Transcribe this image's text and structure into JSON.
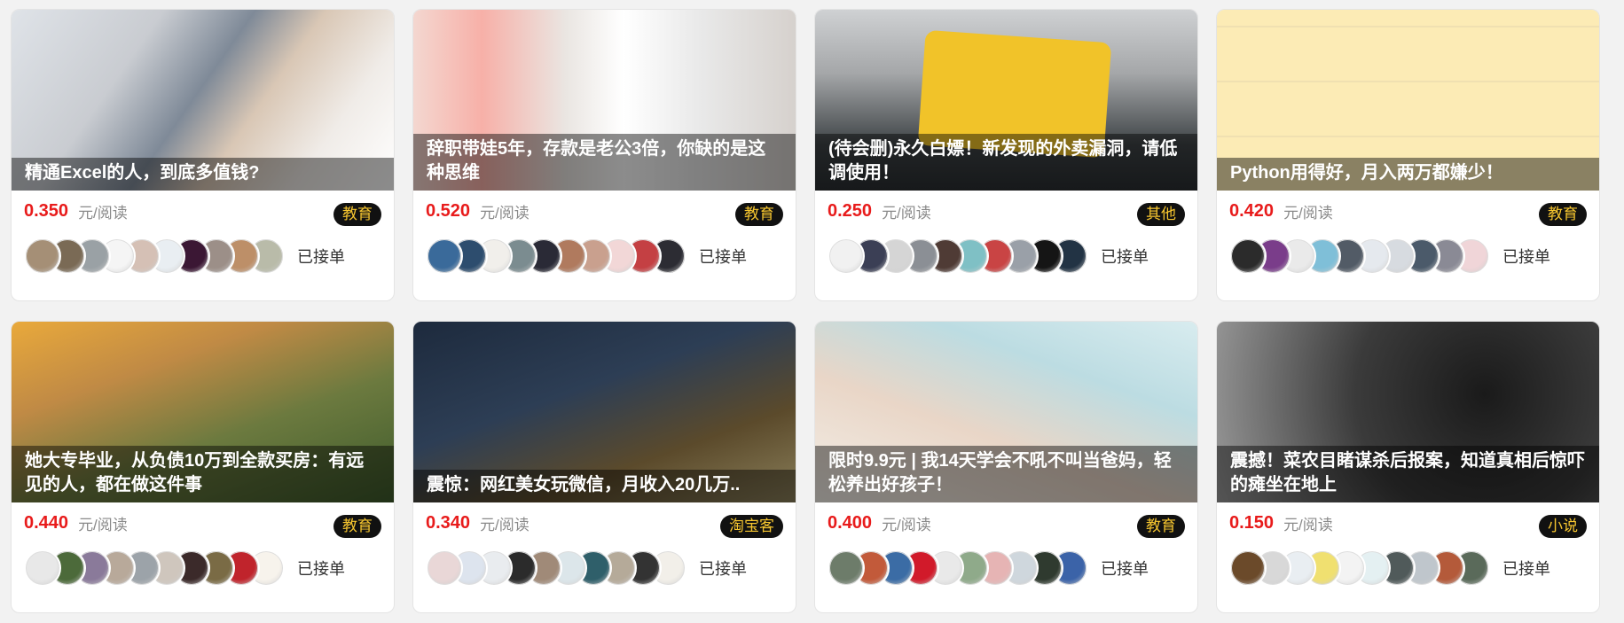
{
  "taken_label": "已接单",
  "price_unit": "元/阅读",
  "colors": {
    "price": "#e81b1b",
    "tag_background": "#111111",
    "tag_text": "#f7c62f"
  },
  "cards": [
    {
      "title": "精通Excel的人，到底多值钱?",
      "price": "0.350",
      "tag": "教育",
      "avatars": [
        "#a58f76",
        "#7a6a55",
        "#9aa1a5",
        "#f5f5f5",
        "#d5c0b5",
        "#e9eef2",
        "#3b1734",
        "#9c8f88",
        "#bd8f68",
        "#b9bba9"
      ]
    },
    {
      "title": "辞职带娃5年，存款是老公3倍，你缺的是这种思维",
      "price": "0.520",
      "tag": "教育",
      "avatars": [
        "#3a6a9a",
        "#2d4d6e",
        "#f1efeb",
        "#7b8c90",
        "#2a2a36",
        "#b07a5e",
        "#c9a08e",
        "#f2d7d7",
        "#c44043",
        "#2c2c33"
      ]
    },
    {
      "title": "(待会删)永久白嫖！新发现的外卖漏洞，请低调使用！",
      "price": "0.250",
      "tag": "其他",
      "avatars": [
        "#f1f1f1",
        "#3b3f55",
        "#d5d5d5",
        "#8b8f95",
        "#4f3b35",
        "#7fc0c5",
        "#c94444",
        "#9aa0a8",
        "#151515",
        "#223344"
      ]
    },
    {
      "title": "Python用得好，月入两万都嫌少！",
      "price": "0.420",
      "tag": "教育",
      "avatars": [
        "#2b2b2b",
        "#7a3d8a",
        "#eaeaea",
        "#7fbfd8",
        "#525b66",
        "#e5e9ee",
        "#d7dbe0",
        "#4b5a6a",
        "#8a8a95",
        "#f0d5d8"
      ]
    },
    {
      "title": "她大专毕业，从负债10万到全款买房：有远见的人，都在做这件事",
      "price": "0.440",
      "tag": "教育",
      "avatars": [
        "#e8e8e8",
        "#4c6a3a",
        "#8a7a9a",
        "#b8a99a",
        "#9ca3a9",
        "#cfc6bd",
        "#3b2a2a",
        "#7a6b45",
        "#c0242c",
        "#f7f3ec"
      ]
    },
    {
      "title": "震惊：网红美女玩微信，月收入20几万..",
      "price": "0.340",
      "tag": "淘宝客",
      "avatars": [
        "#e9d7d7",
        "#dde4ee",
        "#e9ecef",
        "#2b2b2b",
        "#a08a78",
        "#dce6ea",
        "#2f5f6a",
        "#b5aa99",
        "#333",
        "#f2efe9"
      ]
    },
    {
      "title": "限时9.9元 | 我14天学会不吼不叫当爸妈，轻松养出好孩子！",
      "price": "0.400",
      "tag": "教育",
      "avatars": [
        "#6d7c6a",
        "#c25a3a",
        "#3b6ca5",
        "#d11a2a",
        "#e9e9e9",
        "#8faa8a",
        "#e6b4b4",
        "#cfd7dd",
        "#2f3a2f",
        "#3b63a8"
      ]
    },
    {
      "title": "震撼！菜农目睹谋杀后报案，知道真相后惊吓的瘫坐在地上",
      "price": "0.150",
      "tag": "小说",
      "avatars": [
        "#6b4a2a",
        "#d8d8d8",
        "#e9eef2",
        "#f0e070",
        "#f3f3f3",
        "#e4f0f2",
        "#505a5a",
        "#bfc6cc",
        "#b45a3a",
        "#5a6a5a"
      ]
    }
  ]
}
